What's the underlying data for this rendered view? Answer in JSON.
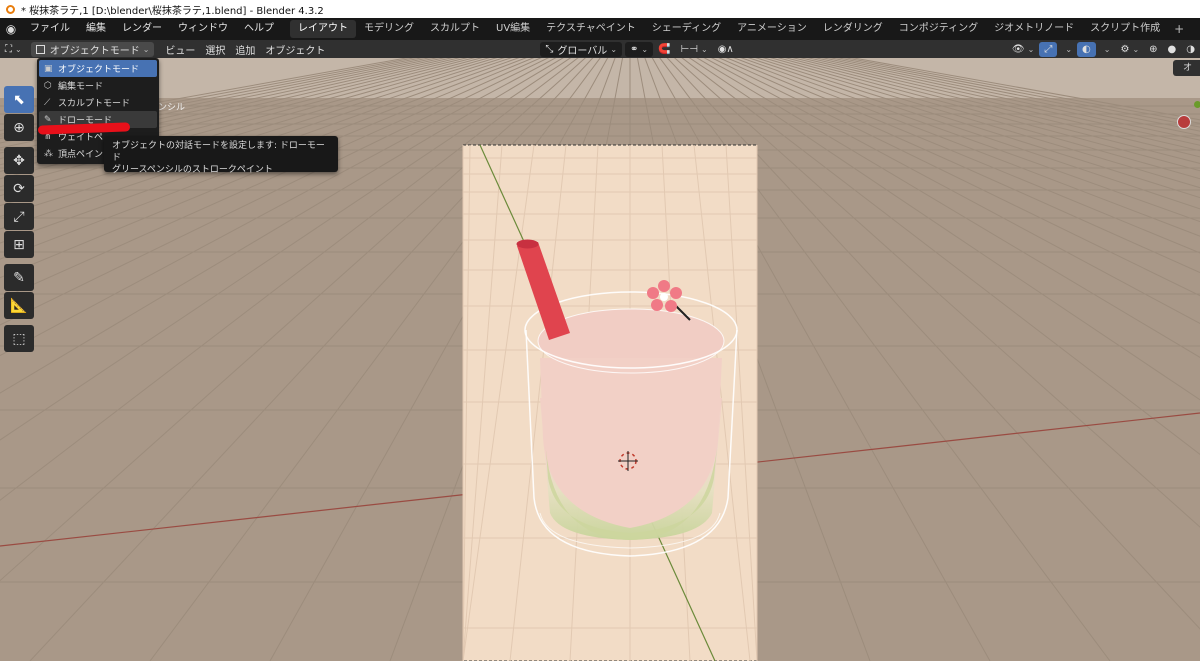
{
  "window": {
    "title": "* 桜抹茶ラテ,1 [D:\\blender\\桜抹茶ラテ,1.blend] - Blender 4.3.2"
  },
  "menu": [
    "ファイル",
    "編集",
    "レンダー",
    "ウィンドウ",
    "ヘルプ"
  ],
  "workspaces": [
    {
      "label": "レイアウト",
      "active": true
    },
    {
      "label": "モデリング"
    },
    {
      "label": "スカルプト"
    },
    {
      "label": "UV編集"
    },
    {
      "label": "テクスチャペイント"
    },
    {
      "label": "シェーディング"
    },
    {
      "label": "アニメーション"
    },
    {
      "label": "レンダリング"
    },
    {
      "label": "コンポジティング"
    },
    {
      "label": "ジオメトリノード"
    },
    {
      "label": "スクリプト作成"
    }
  ],
  "header": {
    "mode": "オブジェクトモード",
    "menus": [
      "ビュー",
      "選択",
      "追加",
      "オブジェクト"
    ],
    "orientation": "グローバル"
  },
  "mode_menu": [
    {
      "label": "オブジェクトモード",
      "icon": "object-mode-icon",
      "selected": true
    },
    {
      "label": "編集モード",
      "icon": "edit-mode-icon"
    },
    {
      "label": "スカルプトモード",
      "icon": "sculpt-mode-icon"
    },
    {
      "label": "ドローモード",
      "icon": "draw-mode-icon",
      "hovered": true
    },
    {
      "label": "ウェイトペ",
      "icon": "weight-paint-icon"
    },
    {
      "label": "頂点ペイン",
      "icon": "vertex-paint-icon"
    }
  ],
  "tooltip": {
    "line1": "オブジェクトの対話モードを設定します: ドローモード",
    "line2": "グリースペンシルのストロークペイント"
  },
  "viewport": {
    "gpencil_label": "ンシル",
    "right_tab": "オ"
  },
  "colors": {
    "accent": "#4772b3",
    "straw": "#e0444e",
    "annotation": "#e8101a"
  }
}
